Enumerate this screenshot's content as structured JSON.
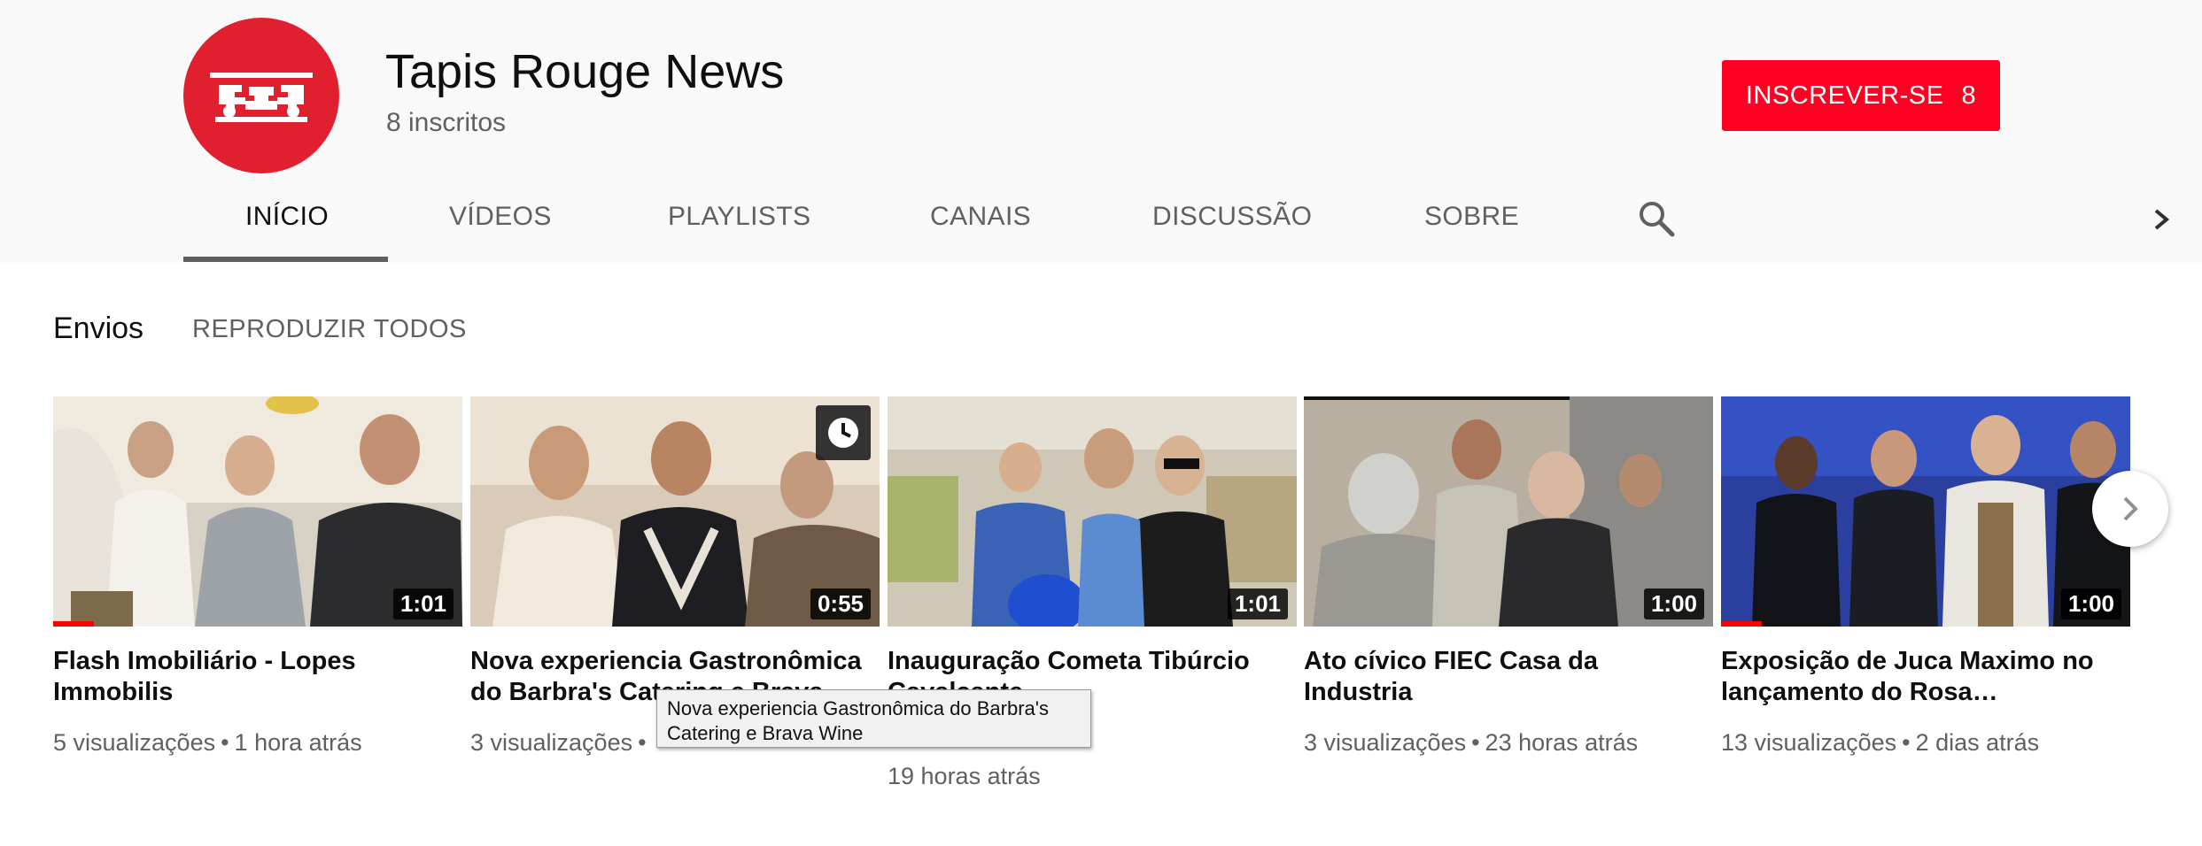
{
  "channel": {
    "name": "Tapis Rouge News",
    "subscribers": "8 inscritos",
    "avatar_color": "#e0202e",
    "subscribe": {
      "label": "INSCREVER-SE",
      "count": "8",
      "color": "#ff0022"
    }
  },
  "tabs": [
    {
      "label": "INÍCIO",
      "active": true
    },
    {
      "label": "VÍDEOS"
    },
    {
      "label": "PLAYLISTS"
    },
    {
      "label": "CANAIS"
    },
    {
      "label": "DISCUSSÃO"
    },
    {
      "label": "SOBRE"
    }
  ],
  "tab_icons": {
    "search": "search-icon",
    "next": "chevron-right-icon"
  },
  "section": {
    "title": "Envios",
    "play_all": "REPRODUZIR TODOS"
  },
  "videos": [
    {
      "title": "Flash Imobiliário - Lopes Immobilis",
      "views": "5 visualizações",
      "age": "1 hora atrás",
      "duration": "1:01",
      "watched_fraction": 0.1
    },
    {
      "title": "Nova experiencia Gastronômica do Barbra's Catering e Brava Wine",
      "views": "3 visualizações",
      "age": "",
      "duration": "0:55",
      "watch_later_icon": "clock-icon"
    },
    {
      "title": "Inauguração Cometa Tibúrcio Cavalcante",
      "views": "",
      "age": "19 horas atrás",
      "duration": "1:01"
    },
    {
      "title": "Ato cívico FIEC Casa da Industria",
      "views": "3 visualizações",
      "age": "23 horas atrás",
      "duration": "1:00"
    },
    {
      "title": "Exposição de Juca Maximo no lançamento do Rosa…",
      "views": "13 visualizações",
      "age": "2 dias atrás",
      "duration": "1:00",
      "watched_fraction": 0.1
    }
  ],
  "tooltip": {
    "text": "Nova experiencia Gastronômica do Barbra's Catering e Brava Wine"
  },
  "carousel": {
    "next_icon": "chevron-right-icon"
  }
}
